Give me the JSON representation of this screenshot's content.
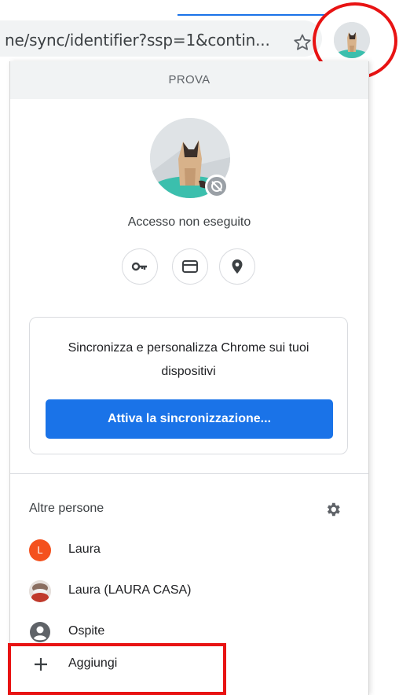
{
  "toolbar": {
    "url_text": "ne/sync/identifier?ssp=1&contin...",
    "star_icon": "star-outline-icon",
    "profile_icon": "profile-avatar-cat"
  },
  "menu": {
    "title": "PROVA",
    "status": "Accesso non eseguito",
    "quick_actions": [
      {
        "icon": "key-icon"
      },
      {
        "icon": "credit-card-icon"
      },
      {
        "icon": "location-pin-icon"
      }
    ],
    "sync_card": {
      "text": "Sincronizza e personalizza Chrome sui tuoi dispositivi",
      "button_label": "Attiva la sincronizzazione..."
    },
    "others_title": "Altre persone",
    "people": [
      {
        "label": "Laura",
        "avatar_letter": "L"
      },
      {
        "label": "Laura (LAURA CASA)"
      },
      {
        "label": "Ospite"
      }
    ],
    "add_label": "Aggiungi"
  },
  "colors": {
    "accent": "#1a73e8",
    "annotation_red": "#e81313",
    "avatar_orange": "#f4511e"
  }
}
